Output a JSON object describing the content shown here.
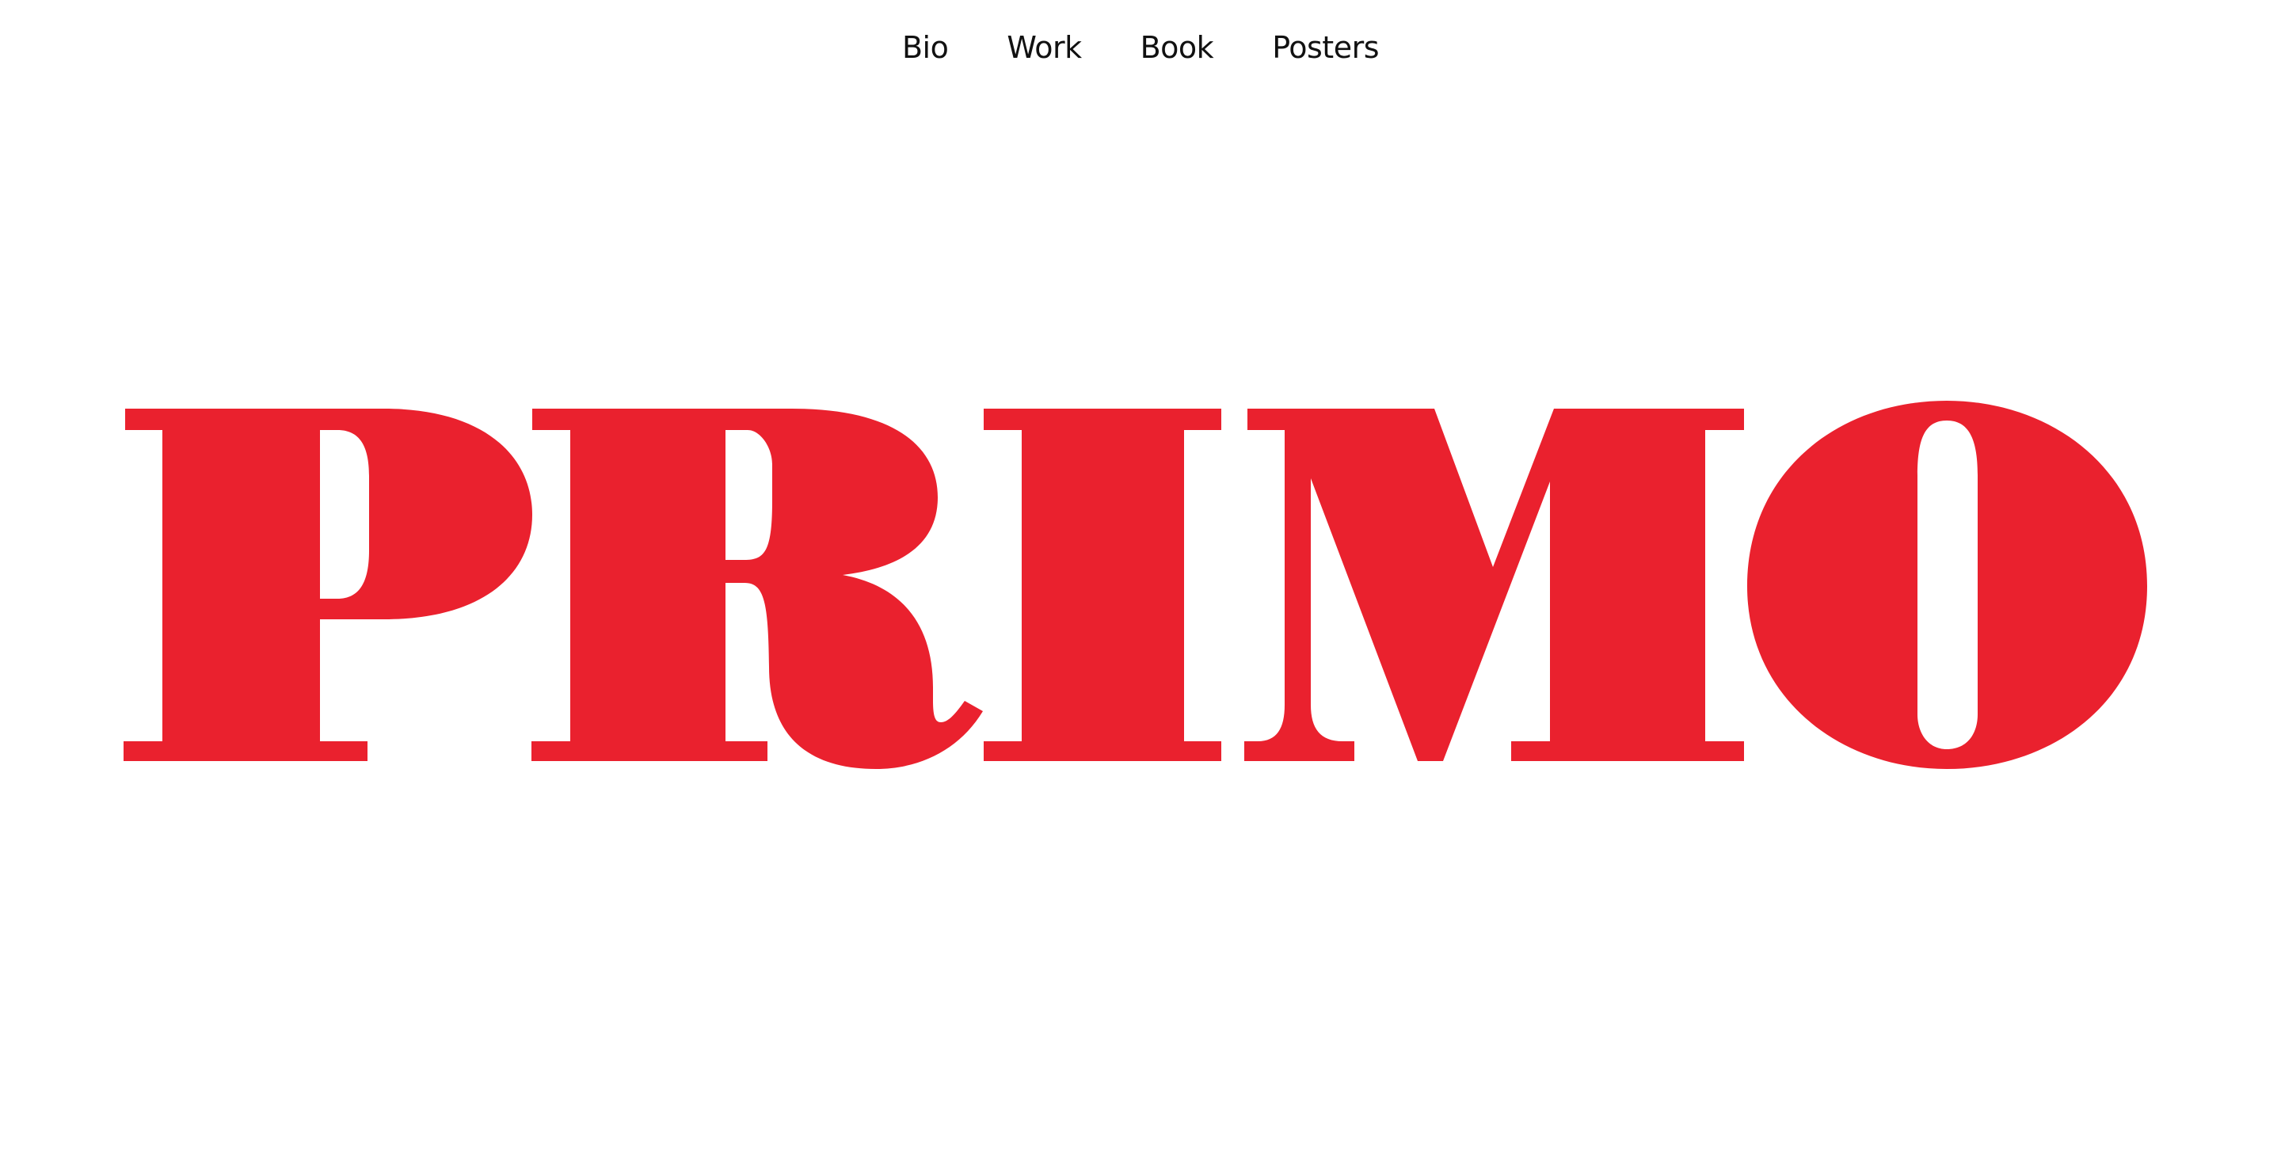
{
  "nav": {
    "items": [
      {
        "label": "Bio"
      },
      {
        "label": "Work"
      },
      {
        "label": "Book"
      },
      {
        "label": "Posters"
      }
    ]
  },
  "logo": {
    "text": "PRIMO",
    "color": "#ea212e"
  },
  "colors": {
    "background": "#ffffff",
    "nav_text": "#111111",
    "brand_red": "#ea212e"
  }
}
